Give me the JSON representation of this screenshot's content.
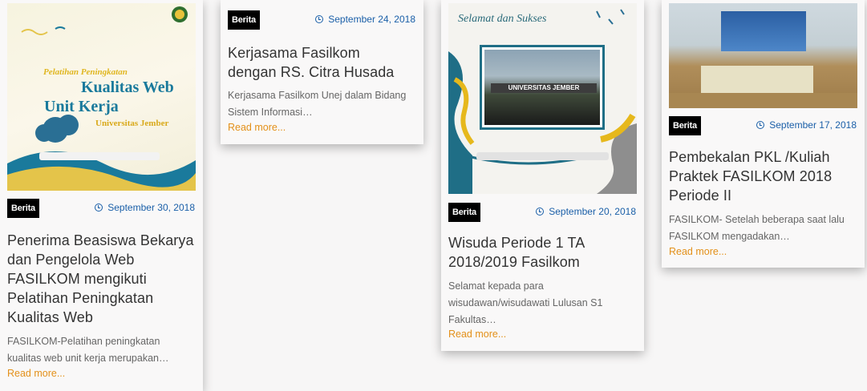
{
  "posts": [
    {
      "category": "Berita",
      "date": "September 30, 2018",
      "title": "Penerima Beasiswa Bekarya dan Pengelola Web FASILKOM mengikuti Pelatihan Peningkatan Kualitas Web",
      "excerpt": "FASILKOM-Pelatihan peningkatan kualitas web unit kerja merupakan…",
      "read_more": "Read more...",
      "thumbnail": {
        "line1": "Pelatihan Peningkatan",
        "line2": "Kualitas Web",
        "line3": "Unit Kerja",
        "line4": "Universitas Jember"
      }
    },
    {
      "category": "Berita",
      "date": "September 24, 2018",
      "title": "Kerjasama Fasilkom dengan RS. Citra Husada",
      "excerpt": "Kerjasama Fasilkom Unej dalam Bidang Sistem Informasi…",
      "read_more": "Read more..."
    },
    {
      "category": "Berita",
      "date": "September 20, 2018",
      "title": "Wisuda Periode 1 TA 2018/2019 Fasilkom",
      "excerpt": "Selamat kepada para wisudawan/wisudawati Lulusan S1 Fakultas…",
      "read_more": "Read more...",
      "thumbnail": {
        "caption": "Selamat dan Sukses",
        "gate": "UNIVERSITAS JEMBER"
      }
    },
    {
      "category": "Berita",
      "date": "September 17, 2018",
      "title": "Pembekalan PKL /Kuliah Praktek FASILKOM 2018 Periode II",
      "excerpt": "FASILKOM- Setelah beberapa saat lalu FASILKOM mengadakan…",
      "read_more": "Read more..."
    }
  ],
  "colors": {
    "badge_bg": "#000000",
    "date": "#1a5fa8",
    "read_more": "#e39019",
    "title": "#333333",
    "excerpt": "#666666"
  },
  "icons": {
    "date": "clock-icon"
  }
}
